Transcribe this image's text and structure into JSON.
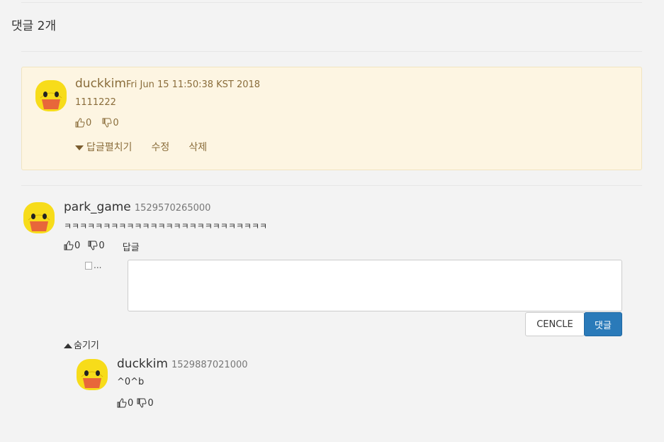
{
  "header": {
    "comment_count": "댓글 2개"
  },
  "own_comment": {
    "author": "duckkim",
    "timestamp": "Fri Jun 15 11:50:38 KST 2018",
    "text": "1111222",
    "likes": "0",
    "dislikes": "0",
    "actions": {
      "expand_replies": "답글펼치기",
      "edit": "수정",
      "delete": "삭제"
    }
  },
  "comment": {
    "author": "park_game",
    "timestamp": "1529570265000",
    "text": "ㅋㅋㅋㅋㅋㅋㅋㅋㅋㅋㅋㅋㅋㅋㅋㅋㅋㅋㅋㅋㅋㅋㅋㅋㅋㅋ",
    "likes": "0",
    "dislikes": "0",
    "reply_label": "답글"
  },
  "reply_form": {
    "avatar_alt": "...",
    "value": "",
    "cancel_label": "CENCLE",
    "submit_label": "댓글"
  },
  "hide_replies_label": "숨기기",
  "reply": {
    "author": "duckkim",
    "timestamp": "1529887021000",
    "text": "^0^b",
    "likes": "0",
    "dislikes": "0"
  },
  "colors": {
    "background": "#f3f3f3",
    "own_card_bg": "#fdf5e2",
    "own_text": "#8a6d3b",
    "submit_button": "#2a7ab9",
    "duck_yellow": "#f7dc1a",
    "duck_beak": "#e8673a"
  },
  "icons": {
    "avatar": "duck-avatar-icon",
    "like": "thumbs-up-icon",
    "dislike": "thumbs-down-icon",
    "expand": "caret-down-icon",
    "collapse": "caret-up-icon"
  }
}
